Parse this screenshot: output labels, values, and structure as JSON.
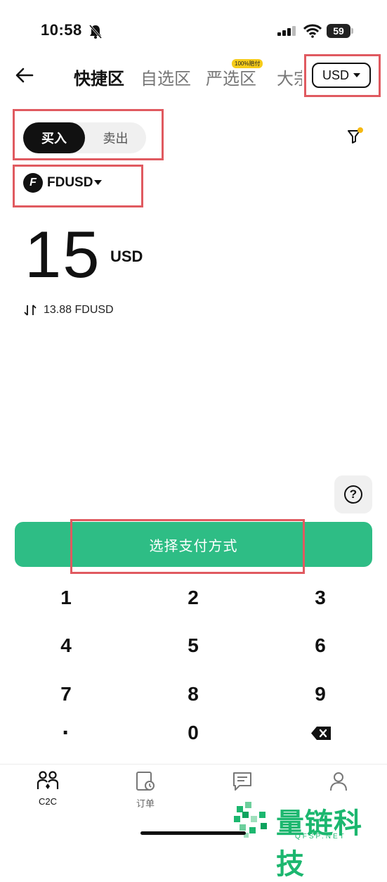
{
  "status_bar": {
    "time": "10:58",
    "battery": "59"
  },
  "nav": {
    "tabs": [
      "快捷区",
      "自选区",
      "严选区",
      "大宗"
    ],
    "tag": "100%赔付",
    "currency": "USD"
  },
  "trade": {
    "buy": "买入",
    "sell": "卖出"
  },
  "coin": {
    "symbol": "FDUSD",
    "icon_letter": "F"
  },
  "amount": {
    "value": "15",
    "unit": "USD",
    "conversion": "13.88 FDUSD"
  },
  "help": "?",
  "pay_button": "选择支付方式",
  "keypad": [
    "1",
    "2",
    "3",
    "4",
    "5",
    "6",
    "7",
    "8",
    "9",
    "·",
    "0"
  ],
  "bottom_nav": [
    {
      "label": "C2C",
      "icon": "people-icon"
    },
    {
      "label": "订单",
      "icon": "order-icon"
    },
    {
      "label": "",
      "icon": "chat-icon"
    },
    {
      "label": "",
      "icon": "profile-icon"
    }
  ],
  "watermark": {
    "text": "量链科技",
    "sub": "QFSP.NET"
  },
  "colors": {
    "accent": "#2ebd85",
    "highlight": "#e05a60",
    "tag": "#f6cc1a",
    "filter_dot": "#f5b912"
  }
}
